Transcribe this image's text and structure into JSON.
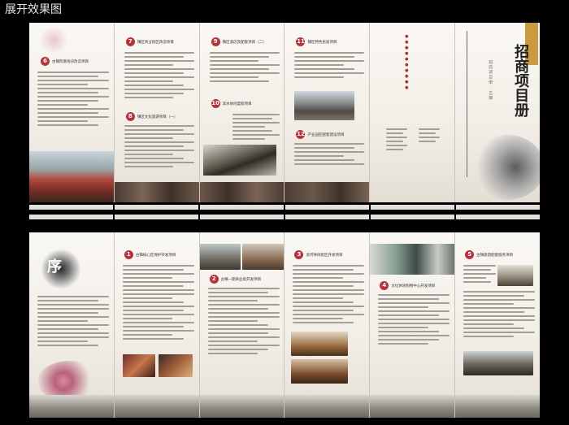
{
  "header": {
    "title": "展开效果图"
  },
  "top_sheet": {
    "sections": [
      {
        "num": "6",
        "title": "古镇院落地块改造项目"
      },
      {
        "num": "7",
        "title": "镇区商业街区改造项目"
      },
      {
        "num": "8",
        "title": "镇区文化旅游项目（一）"
      },
      {
        "num": "9",
        "title": "镇区酒店及配套项目（二）"
      },
      {
        "num": "10",
        "title": "滨水休闲度假项目"
      },
      {
        "num": "11",
        "title": "镇区特色民宿项目"
      },
      {
        "num": "12",
        "title": "产业园区配套建设项目"
      }
    ],
    "cover_title": "招商项目册",
    "cover_sub": "招商项目册 · 古镇"
  },
  "bottom_sheet": {
    "intro_char": "序",
    "sections": [
      {
        "num": "1",
        "title": "古镇核心区保护开发项目"
      },
      {
        "num": "2",
        "title": "古镇一期商业街开发项目"
      },
      {
        "num": "3",
        "title": "滨河休闲街区开发项目"
      },
      {
        "num": "4",
        "title": "文化休闲购物中心开发项目"
      },
      {
        "num": "5",
        "title": "古镇旅游配套服务项目"
      }
    ]
  },
  "colors": {
    "accent": "#b8323a",
    "paper": "#f4f1ec",
    "background": "#000000"
  }
}
